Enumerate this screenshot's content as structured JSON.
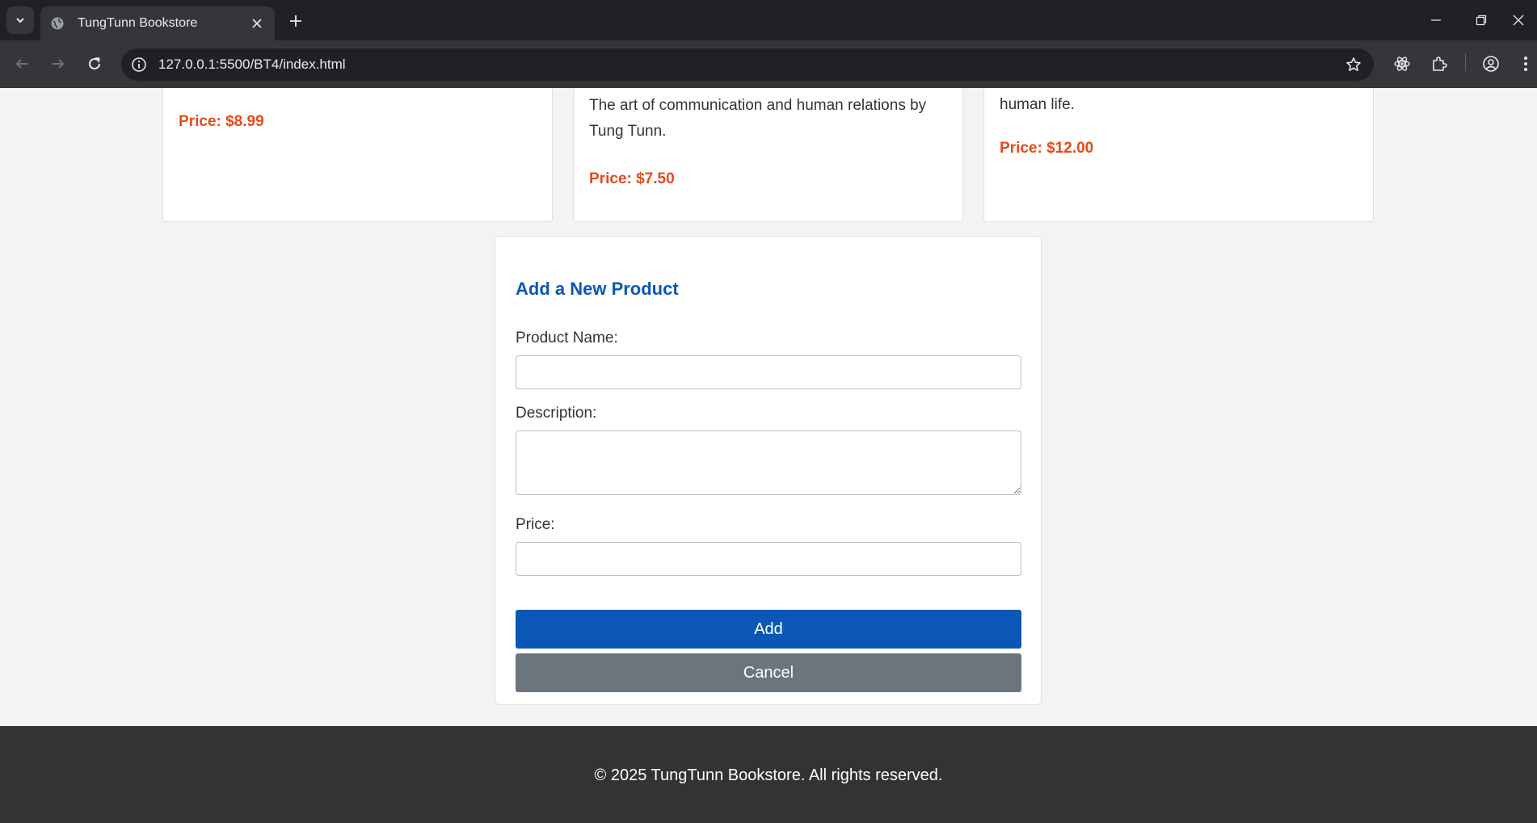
{
  "browser": {
    "tab_title": "TungTunn Bookstore",
    "url": "127.0.0.1:5500/BT4/index.html"
  },
  "products": [
    {
      "description": "",
      "price": "Price: $8.99"
    },
    {
      "description": "The art of communication and human relations by Tung Tunn.",
      "price": "Price: $7.50"
    },
    {
      "description": "human life.",
      "price": "Price: $12.00"
    }
  ],
  "form": {
    "title": "Add a New Product",
    "name_label": "Product Name:",
    "name_value": "",
    "description_label": "Description:",
    "description_value": "",
    "price_label": "Price:",
    "price_value": "",
    "add_label": "Add",
    "cancel_label": "Cancel"
  },
  "footer": {
    "text": "© 2025 TungTunn Bookstore. All rights reserved."
  },
  "colors": {
    "primary": "#0b57b7",
    "price": "#e64a19",
    "secondary": "#6c757d",
    "footer_bg": "#333333"
  }
}
